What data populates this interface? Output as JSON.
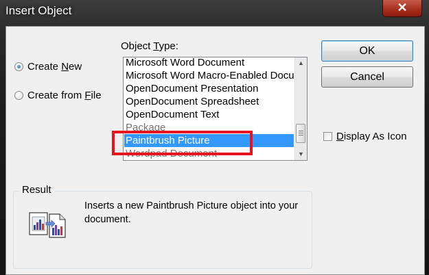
{
  "window": {
    "title": "Insert Object",
    "close_glyph": "✕"
  },
  "options": {
    "create_new": {
      "prefix": "Create ",
      "key": "N",
      "suffix": "ew",
      "checked": true
    },
    "create_from_file": {
      "prefix": "Create from ",
      "key": "F",
      "suffix": "ile",
      "checked": false
    }
  },
  "object_type": {
    "label_prefix": "Object ",
    "label_key": "T",
    "label_suffix": "ype:",
    "items": [
      "Microsoft Word Document",
      "Microsoft Word Macro-Enabled Docu",
      "OpenDocument Presentation",
      "OpenDocument Spreadsheet",
      "OpenDocument Text",
      "Package",
      "Paintbrush Picture",
      "Wordpad Document"
    ],
    "selected": "Paintbrush Picture"
  },
  "buttons": {
    "ok": "OK",
    "cancel": "Cancel"
  },
  "display_as_icon": {
    "prefix": "",
    "key": "D",
    "suffix": "isplay As Icon",
    "checked": false
  },
  "result": {
    "label": "Result",
    "text": "Inserts a new Paintbrush Picture object into your document."
  },
  "colors": {
    "selection": "#3399ff",
    "highlight_box": "#e8141c"
  },
  "icons": {
    "close": "close-icon",
    "result": "insert-object-icon",
    "scroll_up": "scroll-up-arrow-icon",
    "scroll_down": "scroll-down-arrow-icon"
  }
}
